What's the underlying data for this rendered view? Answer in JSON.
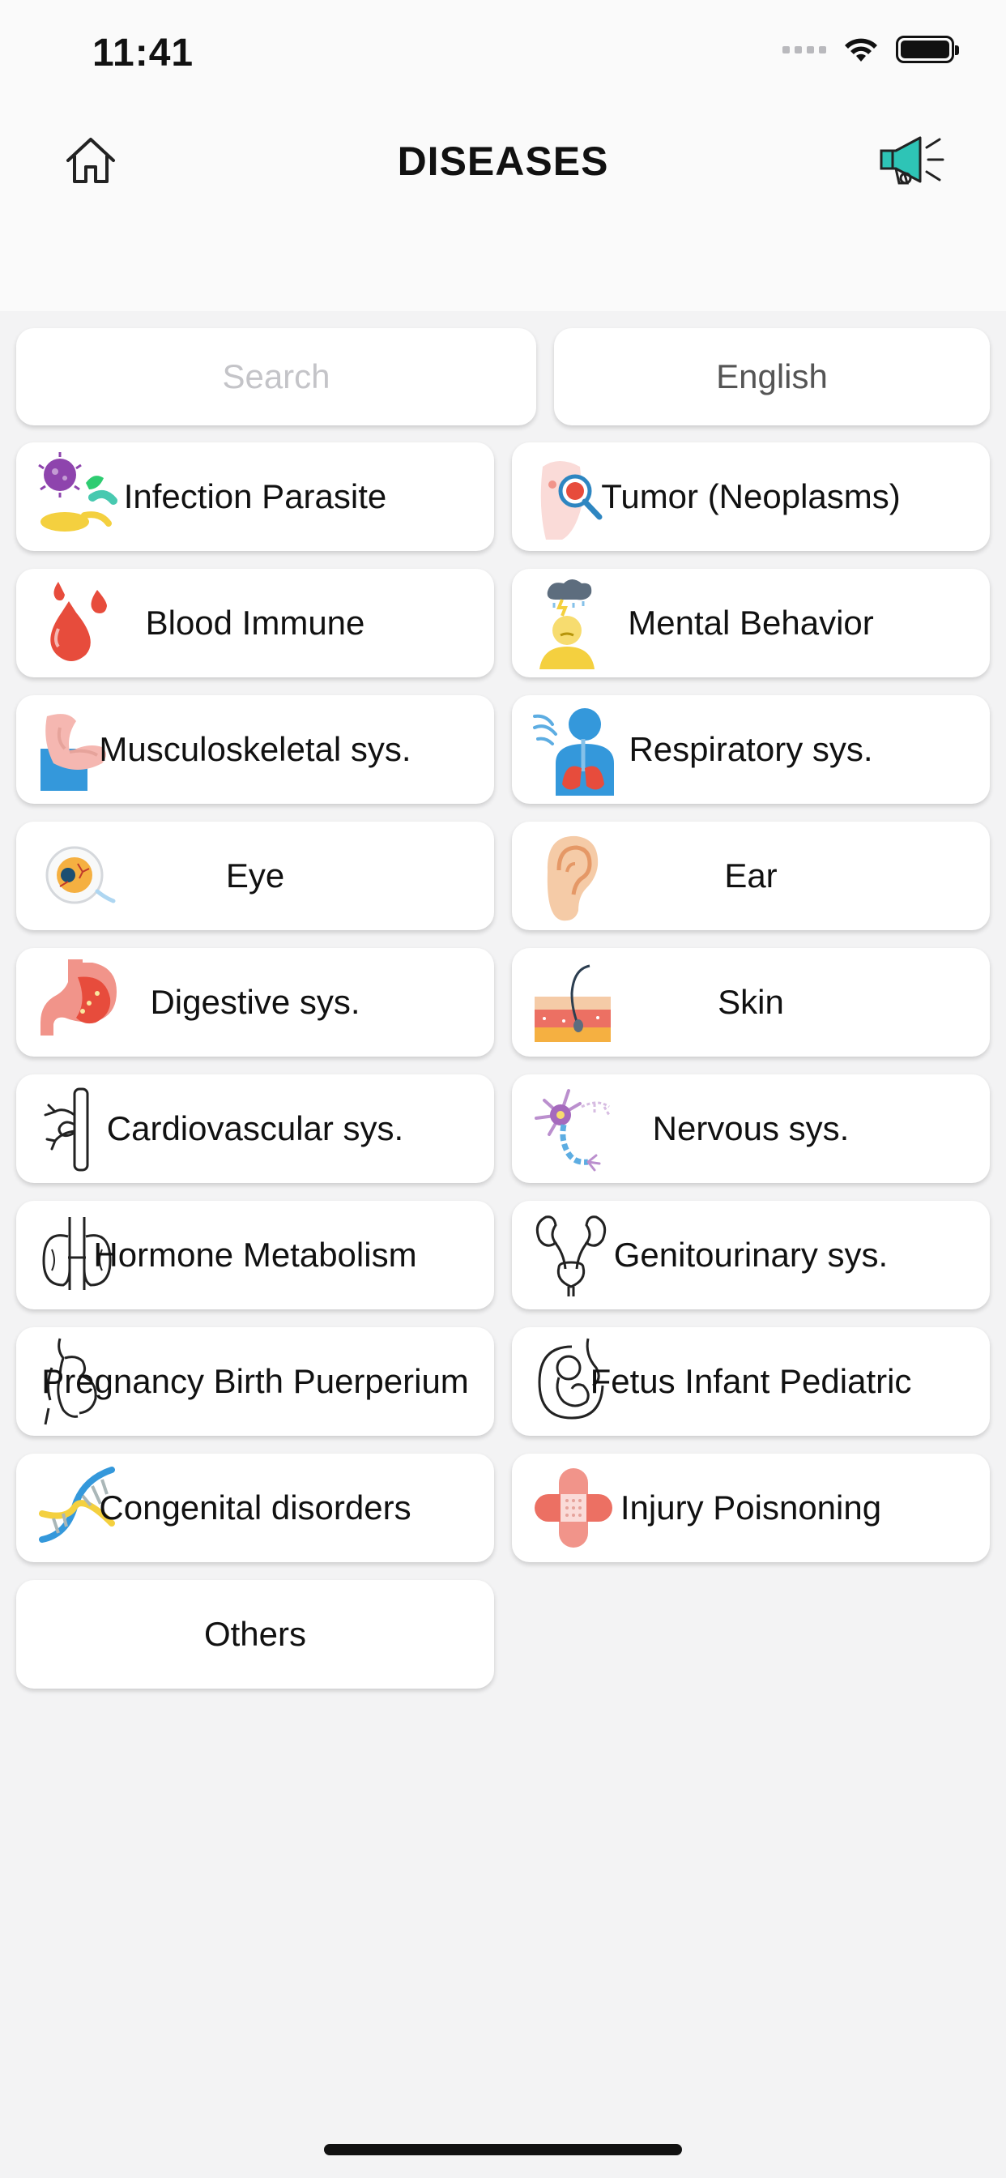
{
  "status_bar": {
    "time": "11:41"
  },
  "nav": {
    "title": "DISEASES"
  },
  "search": {
    "placeholder": "Search",
    "value": ""
  },
  "language": {
    "label": "English"
  },
  "categories": [
    {
      "label": "Infection Parasite",
      "icon": "bacteria-icon"
    },
    {
      "label": "Tumor (Neoplasms)",
      "icon": "tumor-icon"
    },
    {
      "label": "Blood Immune",
      "icon": "blood-drops-icon"
    },
    {
      "label": "Mental Behavior",
      "icon": "mental-stress-icon"
    },
    {
      "label": "Musculoskeletal sys.",
      "icon": "arm-muscle-icon"
    },
    {
      "label": "Respiratory sys.",
      "icon": "lungs-icon"
    },
    {
      "label": "Eye",
      "icon": "eye-icon"
    },
    {
      "label": "Ear",
      "icon": "ear-icon"
    },
    {
      "label": "Digestive sys.",
      "icon": "stomach-icon"
    },
    {
      "label": "Skin",
      "icon": "skin-layer-icon"
    },
    {
      "label": "Cardiovascular sys.",
      "icon": "blood-vessel-icon"
    },
    {
      "label": "Nervous sys.",
      "icon": "neuron-icon"
    },
    {
      "label": "Hormone Metabolism",
      "icon": "thyroid-icon"
    },
    {
      "label": "Genitourinary sys.",
      "icon": "kidneys-icon"
    },
    {
      "label": "Pregnancy Birth Puerperium",
      "icon": "pregnant-woman-icon"
    },
    {
      "label": "Fetus Infant Pediatric",
      "icon": "fetus-icon"
    },
    {
      "label": "Congenital disorders",
      "icon": "dna-icon"
    },
    {
      "label": "Injury Poisnoning",
      "icon": "bandage-icon"
    },
    {
      "label": "Others",
      "icon": ""
    }
  ],
  "colors": {
    "background": "#f3f3f4",
    "card": "#ffffff",
    "accent": "#2ec4b6"
  }
}
